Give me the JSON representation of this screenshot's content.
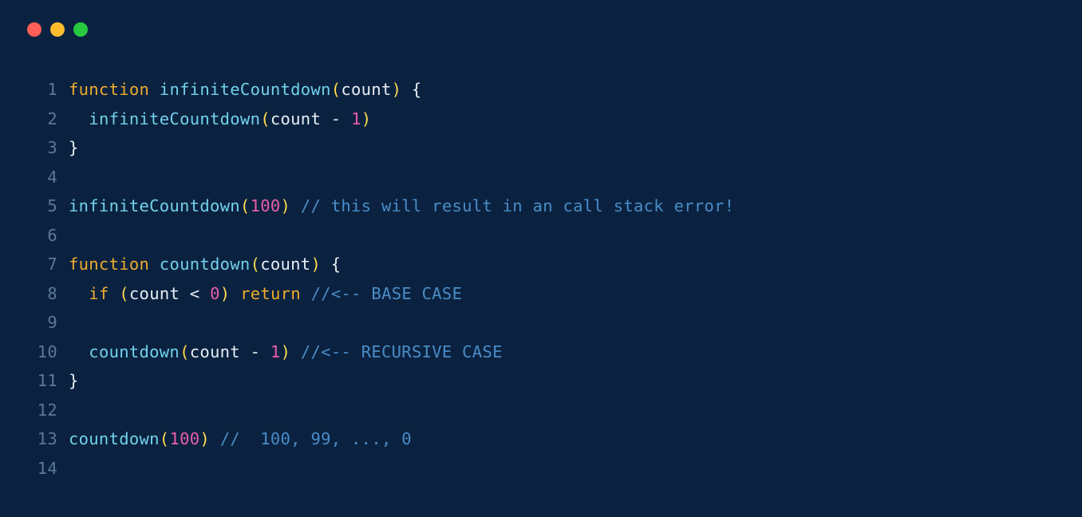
{
  "window_controls": {
    "red": "close",
    "yellow": "minimize",
    "green": "maximize"
  },
  "code": {
    "lines": [
      {
        "num": "1",
        "tokens": [
          {
            "cls": "tok-keyword",
            "text": "function"
          },
          {
            "cls": "",
            "text": " "
          },
          {
            "cls": "tok-function",
            "text": "infiniteCountdown"
          },
          {
            "cls": "tok-paren",
            "text": "("
          },
          {
            "cls": "tok-param",
            "text": "count"
          },
          {
            "cls": "tok-paren",
            "text": ")"
          },
          {
            "cls": "",
            "text": " "
          },
          {
            "cls": "tok-brace",
            "text": "{"
          }
        ]
      },
      {
        "num": "2",
        "tokens": [
          {
            "cls": "",
            "text": "  "
          },
          {
            "cls": "tok-function",
            "text": "infiniteCountdown"
          },
          {
            "cls": "tok-paren",
            "text": "("
          },
          {
            "cls": "tok-param",
            "text": "count"
          },
          {
            "cls": "",
            "text": " "
          },
          {
            "cls": "tok-op",
            "text": "-"
          },
          {
            "cls": "",
            "text": " "
          },
          {
            "cls": "tok-number",
            "text": "1"
          },
          {
            "cls": "tok-paren",
            "text": ")"
          }
        ]
      },
      {
        "num": "3",
        "tokens": [
          {
            "cls": "tok-brace",
            "text": "}"
          }
        ]
      },
      {
        "num": "4",
        "tokens": []
      },
      {
        "num": "5",
        "tokens": [
          {
            "cls": "tok-function",
            "text": "infiniteCountdown"
          },
          {
            "cls": "tok-paren",
            "text": "("
          },
          {
            "cls": "tok-number",
            "text": "100"
          },
          {
            "cls": "tok-paren",
            "text": ")"
          },
          {
            "cls": "",
            "text": " "
          },
          {
            "cls": "tok-comment",
            "text": "// this will result in an call stack error!"
          }
        ]
      },
      {
        "num": "6",
        "tokens": []
      },
      {
        "num": "7",
        "tokens": [
          {
            "cls": "tok-keyword",
            "text": "function"
          },
          {
            "cls": "",
            "text": " "
          },
          {
            "cls": "tok-function",
            "text": "countdown"
          },
          {
            "cls": "tok-paren",
            "text": "("
          },
          {
            "cls": "tok-param",
            "text": "count"
          },
          {
            "cls": "tok-paren",
            "text": ")"
          },
          {
            "cls": "",
            "text": " "
          },
          {
            "cls": "tok-brace",
            "text": "{"
          }
        ]
      },
      {
        "num": "8",
        "tokens": [
          {
            "cls": "",
            "text": "  "
          },
          {
            "cls": "tok-if",
            "text": "if"
          },
          {
            "cls": "",
            "text": " "
          },
          {
            "cls": "tok-paren",
            "text": "("
          },
          {
            "cls": "tok-param",
            "text": "count"
          },
          {
            "cls": "",
            "text": " "
          },
          {
            "cls": "tok-op",
            "text": "<"
          },
          {
            "cls": "",
            "text": " "
          },
          {
            "cls": "tok-number",
            "text": "0"
          },
          {
            "cls": "tok-paren",
            "text": ")"
          },
          {
            "cls": "",
            "text": " "
          },
          {
            "cls": "tok-return",
            "text": "return"
          },
          {
            "cls": "",
            "text": " "
          },
          {
            "cls": "tok-comment",
            "text": "//<-- BASE CASE"
          }
        ]
      },
      {
        "num": "9",
        "tokens": []
      },
      {
        "num": "10",
        "tokens": [
          {
            "cls": "",
            "text": "  "
          },
          {
            "cls": "tok-function",
            "text": "countdown"
          },
          {
            "cls": "tok-paren",
            "text": "("
          },
          {
            "cls": "tok-param",
            "text": "count"
          },
          {
            "cls": "",
            "text": " "
          },
          {
            "cls": "tok-op",
            "text": "-"
          },
          {
            "cls": "",
            "text": " "
          },
          {
            "cls": "tok-number",
            "text": "1"
          },
          {
            "cls": "tok-paren",
            "text": ")"
          },
          {
            "cls": "",
            "text": " "
          },
          {
            "cls": "tok-comment",
            "text": "//<-- RECURSIVE CASE"
          }
        ]
      },
      {
        "num": "11",
        "tokens": [
          {
            "cls": "tok-brace",
            "text": "}"
          }
        ]
      },
      {
        "num": "12",
        "tokens": []
      },
      {
        "num": "13",
        "tokens": [
          {
            "cls": "tok-function",
            "text": "countdown"
          },
          {
            "cls": "tok-paren",
            "text": "("
          },
          {
            "cls": "tok-number",
            "text": "100"
          },
          {
            "cls": "tok-paren",
            "text": ")"
          },
          {
            "cls": "",
            "text": " "
          },
          {
            "cls": "tok-comment",
            "text": "//  100, 99, ..., 0"
          }
        ]
      },
      {
        "num": "14",
        "tokens": []
      }
    ]
  }
}
